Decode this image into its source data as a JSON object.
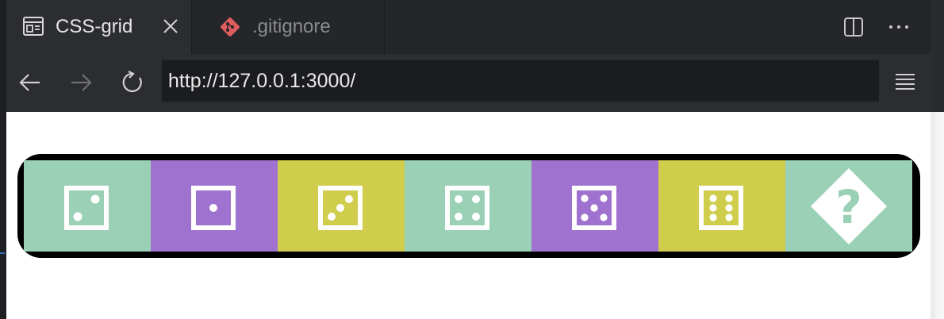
{
  "tabs": [
    {
      "label": "CSS-grid",
      "icon": "preview-icon",
      "active": true
    },
    {
      "label": ".gitignore",
      "icon": "git-icon",
      "active": false
    }
  ],
  "address_bar": {
    "url": "http://127.0.0.1:3000/"
  },
  "colors": {
    "teal": "#9ad0b6",
    "purple": "#a072cf",
    "yellow": "#cfcd4b",
    "git": "#e05d5d"
  },
  "grid_items": [
    {
      "icon": "dice-two-icon",
      "color": "teal"
    },
    {
      "icon": "dice-one-icon",
      "color": "purple"
    },
    {
      "icon": "dice-three-icon",
      "color": "yellow"
    },
    {
      "icon": "dice-four-icon",
      "color": "teal"
    },
    {
      "icon": "dice-five-icon",
      "color": "purple"
    },
    {
      "icon": "dice-six-icon",
      "color": "yellow"
    },
    {
      "icon": "question-diamond-icon",
      "color": "teal"
    }
  ]
}
